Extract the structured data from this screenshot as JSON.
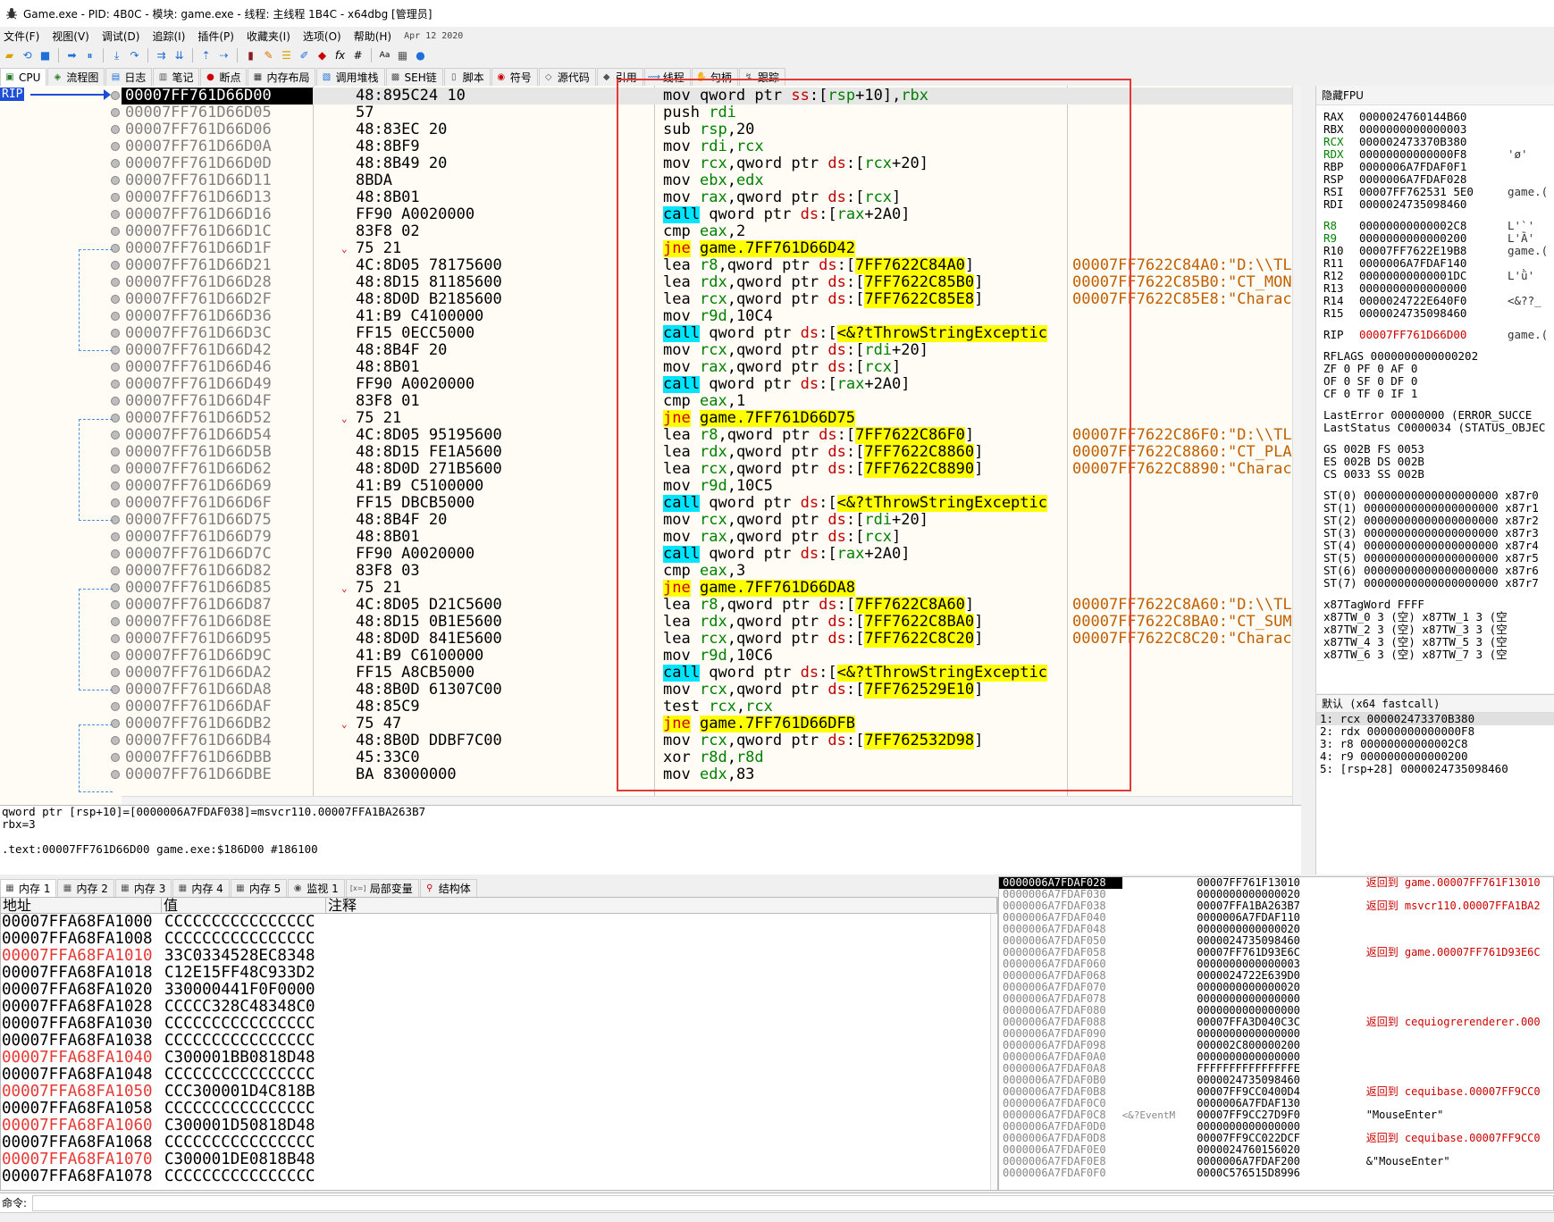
{
  "window": {
    "title": "Game.exe - PID: 4B0C - 模块: game.exe - 线程: 主线程 1B4C - x64dbg [管理员]"
  },
  "menu": [
    {
      "label": "文件(F)"
    },
    {
      "label": "视图(V)"
    },
    {
      "label": "调试(D)"
    },
    {
      "label": "追踪(I)"
    },
    {
      "label": "插件(P)"
    },
    {
      "label": "收藏夹(I)"
    },
    {
      "label": "选项(O)"
    },
    {
      "label": "帮助(H)"
    }
  ],
  "build_date": "Apr 12 2020",
  "tabs": [
    {
      "label": "CPU"
    },
    {
      "label": "流程图"
    },
    {
      "label": "日志"
    },
    {
      "label": "笔记"
    },
    {
      "label": "断点"
    },
    {
      "label": "内存布局"
    },
    {
      "label": "调用堆栈"
    },
    {
      "label": "SEH链"
    },
    {
      "label": "脚本"
    },
    {
      "label": "符号"
    },
    {
      "label": "源代码"
    },
    {
      "label": "引用"
    },
    {
      "label": "线程"
    },
    {
      "label": "句柄"
    },
    {
      "label": "跟踪"
    }
  ],
  "rip_label": "RIP",
  "disasm": [
    {
      "addr": "00007FF761D66D00",
      "bytes": "48:895C24 10",
      "ins": "mov qword ptr ss:[rsp+10],rbx",
      "cmt": "",
      "cur": true
    },
    {
      "addr": "00007FF761D66D05",
      "bytes": "57",
      "ins": "push rdi",
      "cmt": ""
    },
    {
      "addr": "00007FF761D66D06",
      "bytes": "48:83EC 20",
      "ins": "sub rsp,20",
      "cmt": ""
    },
    {
      "addr": "00007FF761D66D0A",
      "bytes": "48:8BF9",
      "ins": "mov rdi,rcx",
      "cmt": ""
    },
    {
      "addr": "00007FF761D66D0D",
      "bytes": "48:8B49 20",
      "ins": "mov rcx,qword ptr ds:[rcx+20]",
      "cmt": ""
    },
    {
      "addr": "00007FF761D66D11",
      "bytes": "8BDA",
      "ins": "mov ebx,edx",
      "cmt": ""
    },
    {
      "addr": "00007FF761D66D13",
      "bytes": "48:8B01",
      "ins": "mov rax,qword ptr ds:[rcx]",
      "cmt": ""
    },
    {
      "addr": "00007FF761D66D16",
      "bytes": "FF90 A0020000",
      "ins": "call qword ptr ds:[rax+2A0]",
      "cmt": "",
      "mn": "call"
    },
    {
      "addr": "00007FF761D66D1C",
      "bytes": "83F8 02",
      "ins": "cmp eax,2",
      "cmt": ""
    },
    {
      "addr": "00007FF761D66D1F",
      "bytes": "75 21",
      "ins": "jne game.7FF761D66D42",
      "cmt": "",
      "mn": "jcc",
      "jarrow": true
    },
    {
      "addr": "00007FF761D66D21",
      "bytes": "4C:8D05 78175600",
      "ins": "lea r8,qword ptr ds:[7FF7622C84A0]",
      "cmt": "00007FF7622C84A0:\"D:\\\\TL"
    },
    {
      "addr": "00007FF761D66D28",
      "bytes": "48:8D15 81185600",
      "ins": "lea rdx,qword ptr ds:[7FF7622C85B0]",
      "cmt": "00007FF7622C85B0:\"CT_MON"
    },
    {
      "addr": "00007FF761D66D2F",
      "bytes": "48:8D0D B2185600",
      "ins": "lea rcx,qword ptr ds:[7FF7622C85E8]",
      "cmt": "00007FF7622C85E8:\"Charac"
    },
    {
      "addr": "00007FF761D66D36",
      "bytes": "41:B9 C4100000",
      "ins": "mov r9d,10C4",
      "cmt": ""
    },
    {
      "addr": "00007FF761D66D3C",
      "bytes": "FF15 0ECC5000",
      "ins": "call qword ptr ds:[<&?tThrowStringExceptic",
      "cmt": "",
      "mn": "call"
    },
    {
      "addr": "00007FF761D66D42",
      "bytes": "48:8B4F 20",
      "ins": "mov rcx,qword ptr ds:[rdi+20]",
      "cmt": ""
    },
    {
      "addr": "00007FF761D66D46",
      "bytes": "48:8B01",
      "ins": "mov rax,qword ptr ds:[rcx]",
      "cmt": ""
    },
    {
      "addr": "00007FF761D66D49",
      "bytes": "FF90 A0020000",
      "ins": "call qword ptr ds:[rax+2A0]",
      "cmt": "",
      "mn": "call"
    },
    {
      "addr": "00007FF761D66D4F",
      "bytes": "83F8 01",
      "ins": "cmp eax,1",
      "cmt": ""
    },
    {
      "addr": "00007FF761D66D52",
      "bytes": "75 21",
      "ins": "jne game.7FF761D66D75",
      "cmt": "",
      "mn": "jcc",
      "jarrow": true
    },
    {
      "addr": "00007FF761D66D54",
      "bytes": "4C:8D05 95195600",
      "ins": "lea r8,qword ptr ds:[7FF7622C86F0]",
      "cmt": "00007FF7622C86F0:\"D:\\\\TL"
    },
    {
      "addr": "00007FF761D66D5B",
      "bytes": "48:8D15 FE1A5600",
      "ins": "lea rdx,qword ptr ds:[7FF7622C8860]",
      "cmt": "00007FF7622C8860:\"CT_PLA"
    },
    {
      "addr": "00007FF761D66D62",
      "bytes": "48:8D0D 271B5600",
      "ins": "lea rcx,qword ptr ds:[7FF7622C8890]",
      "cmt": "00007FF7622C8890:\"Charac"
    },
    {
      "addr": "00007FF761D66D69",
      "bytes": "41:B9 C5100000",
      "ins": "mov r9d,10C5",
      "cmt": ""
    },
    {
      "addr": "00007FF761D66D6F",
      "bytes": "FF15 DBCB5000",
      "ins": "call qword ptr ds:[<&?tThrowStringExceptic",
      "cmt": "",
      "mn": "call"
    },
    {
      "addr": "00007FF761D66D75",
      "bytes": "48:8B4F 20",
      "ins": "mov rcx,qword ptr ds:[rdi+20]",
      "cmt": ""
    },
    {
      "addr": "00007FF761D66D79",
      "bytes": "48:8B01",
      "ins": "mov rax,qword ptr ds:[rcx]",
      "cmt": ""
    },
    {
      "addr": "00007FF761D66D7C",
      "bytes": "FF90 A0020000",
      "ins": "call qword ptr ds:[rax+2A0]",
      "cmt": "",
      "mn": "call"
    },
    {
      "addr": "00007FF761D66D82",
      "bytes": "83F8 03",
      "ins": "cmp eax,3",
      "cmt": ""
    },
    {
      "addr": "00007FF761D66D85",
      "bytes": "75 21",
      "ins": "jne game.7FF761D66DA8",
      "cmt": "",
      "mn": "jcc",
      "jarrow": true
    },
    {
      "addr": "00007FF761D66D87",
      "bytes": "4C:8D05 D21C5600",
      "ins": "lea r8,qword ptr ds:[7FF7622C8A60]",
      "cmt": "00007FF7622C8A60:\"D:\\\\TL"
    },
    {
      "addr": "00007FF761D66D8E",
      "bytes": "48:8D15 0B1E5600",
      "ins": "lea rdx,qword ptr ds:[7FF7622C8BA0]",
      "cmt": "00007FF7622C8BA0:\"CT_SUM"
    },
    {
      "addr": "00007FF761D66D95",
      "bytes": "48:8D0D 841E5600",
      "ins": "lea rcx,qword ptr ds:[7FF7622C8C20]",
      "cmt": "00007FF7622C8C20:\"Charac"
    },
    {
      "addr": "00007FF761D66D9C",
      "bytes": "41:B9 C6100000",
      "ins": "mov r9d,10C6",
      "cmt": ""
    },
    {
      "addr": "00007FF761D66DA2",
      "bytes": "FF15 A8CB5000",
      "ins": "call qword ptr ds:[<&?tThrowStringExceptic",
      "cmt": "",
      "mn": "call"
    },
    {
      "addr": "00007FF761D66DA8",
      "bytes": "48:8B0D 61307C00",
      "ins": "mov rcx,qword ptr ds:[7FF762529E10]",
      "cmt": ""
    },
    {
      "addr": "00007FF761D66DAF",
      "bytes": "48:85C9",
      "ins": "test rcx,rcx",
      "cmt": ""
    },
    {
      "addr": "00007FF761D66DB2",
      "bytes": "75 47",
      "ins": "jne game.7FF761D66DFB",
      "cmt": "",
      "mn": "jcc",
      "jarrow": true
    },
    {
      "addr": "00007FF761D66DB4",
      "bytes": "48:8B0D DDBF7C00",
      "ins": "mov rcx,qword ptr ds:[7FF762532D98]",
      "cmt": ""
    },
    {
      "addr": "00007FF761D66DBB",
      "bytes": "45:33C0",
      "ins": "xor r8d,r8d",
      "cmt": ""
    },
    {
      "addr": "00007FF761D66DBE",
      "bytes": "BA 83000000",
      "ins": "mov edx,83",
      "cmt": ""
    }
  ],
  "registers": {
    "header": "隐藏FPU",
    "gp": [
      {
        "n": "RAX",
        "v": "0000024760144B60",
        "x": ""
      },
      {
        "n": "RBX",
        "v": "0000000000000003",
        "x": ""
      },
      {
        "n": "RCX",
        "v": "000002473370B380",
        "x": "",
        "ch": true
      },
      {
        "n": "RDX",
        "v": "00000000000000F8",
        "x": "'ø'",
        "ch": true
      },
      {
        "n": "RBP",
        "v": "0000006A7FDAF0F1",
        "x": ""
      },
      {
        "n": "RSP",
        "v": "0000006A7FDAF028",
        "x": ""
      },
      {
        "n": "RSI",
        "v": "00007FF762531 5E0",
        "x": "game.("
      },
      {
        "n": "RDI",
        "v": "0000024735098460",
        "x": ""
      }
    ],
    "ext": [
      {
        "n": "R8",
        "v": "00000000000002C8",
        "x": "L'`'",
        "ch": true
      },
      {
        "n": "R9",
        "v": "0000000000000200",
        "x": "L'Ȁ'",
        "ch": true
      },
      {
        "n": "R10",
        "v": "00007FF7622E19B8",
        "x": "game.("
      },
      {
        "n": "R11",
        "v": "0000006A7FDAF140",
        "x": ""
      },
      {
        "n": "R12",
        "v": "00000000000001DC",
        "x": "L'ǜ'"
      },
      {
        "n": "R13",
        "v": "0000000000000000",
        "x": ""
      },
      {
        "n": "R14",
        "v": "0000024722E640F0",
        "x": "<&??_"
      },
      {
        "n": "R15",
        "v": "0000024735098460",
        "x": ""
      }
    ],
    "rip": {
      "n": "RIP",
      "v": "00007FF761D66D00",
      "x": "game.("
    },
    "flags": [
      "RFLAGS   0000000000000202",
      "ZF 0  PF 0  AF 0",
      "OF 0  SF 0  DF 0",
      "CF 0  TF 0  IF 1"
    ],
    "errors": [
      "LastError  00000000 (ERROR_SUCCE",
      "LastStatus C0000034 (STATUS_OBJEC"
    ],
    "segs": [
      "GS 002B  FS 0053",
      "ES 002B  DS 002B",
      "CS 0033  SS 002B"
    ],
    "fpu": [
      "ST(0) 00000000000000000000 x87r0",
      "ST(1) 00000000000000000000 x87r1",
      "ST(2) 00000000000000000000 x87r2",
      "ST(3) 00000000000000000000 x87r3",
      "ST(4) 00000000000000000000 x87r4",
      "ST(5) 00000000000000000000 x87r5",
      "ST(6) 00000000000000000000 x87r6",
      "ST(7) 00000000000000000000 x87r7"
    ],
    "tag": [
      "x87TagWord FFFF",
      "x87TW_0 3 (空)     x87TW_1 3 (空",
      "x87TW_2 3 (空)     x87TW_3 3 (空",
      "x87TW_4 3 (空)     x87TW_5 3 (空",
      "x87TW_6 3 (空)     x87TW_7 3 (空"
    ]
  },
  "args": {
    "header": "默认 (x64 fastcall)",
    "rows": [
      "1: rcx 000002473370B380",
      "2: rdx 00000000000000F8",
      "3: r8 00000000000002C8",
      "4: r9 0000000000000200",
      "5: [rsp+28] 0000024735098460"
    ]
  },
  "info": [
    "qword ptr [rsp+10]=[0000006A7FDAF038]=msvcr110.00007FFA1BA263B7",
    "rbx=3",
    "",
    ".text:00007FF761D66D00 game.exe:$186D00 #186100"
  ],
  "dump_tabs": [
    {
      "label": "内存 1"
    },
    {
      "label": "内存 2"
    },
    {
      "label": "内存 3"
    },
    {
      "label": "内存 4"
    },
    {
      "label": "内存 5"
    },
    {
      "label": "监视 1"
    },
    {
      "label": "局部变量"
    },
    {
      "label": "结构体"
    }
  ],
  "dump": {
    "headers": [
      "地址",
      "值",
      "注释"
    ],
    "rows": [
      {
        "a": "00007FFA68FA1000",
        "v": "CCCCCCCCCCCCCCCC"
      },
      {
        "a": "00007FFA68FA1008",
        "v": "CCCCCCCCCCCCCCCC"
      },
      {
        "a": "00007FFA68FA1010",
        "v": "33C0334528EC8348",
        "red": true
      },
      {
        "a": "00007FFA68FA1018",
        "v": "C12E15FF48C933D2"
      },
      {
        "a": "00007FFA68FA1020",
        "v": "330000441F0F0000"
      },
      {
        "a": "00007FFA68FA1028",
        "v": "CCCCC328C48348C0"
      },
      {
        "a": "00007FFA68FA1030",
        "v": "CCCCCCCCCCCCCCCC"
      },
      {
        "a": "00007FFA68FA1038",
        "v": "CCCCCCCCCCCCCCCC"
      },
      {
        "a": "00007FFA68FA1040",
        "v": "C300001BB0818D48",
        "red": true
      },
      {
        "a": "00007FFA68FA1048",
        "v": "CCCCCCCCCCCCCCCC"
      },
      {
        "a": "00007FFA68FA1050",
        "v": "CCC300001D4C818B",
        "red": true
      },
      {
        "a": "00007FFA68FA1058",
        "v": "CCCCCCCCCCCCCCCC"
      },
      {
        "a": "00007FFA68FA1060",
        "v": "C300001D50818D48",
        "red": true
      },
      {
        "a": "00007FFA68FA1068",
        "v": "CCCCCCCCCCCCCCCC"
      },
      {
        "a": "00007FFA68FA1070",
        "v": "C300001DE0818B48",
        "red": true
      },
      {
        "a": "00007FFA68FA1078",
        "v": "CCCCCCCCCCCCCCCC"
      }
    ]
  },
  "stack": [
    {
      "a": "0000006A7FDAF028",
      "x": "",
      "v": "00007FF761F13010",
      "c": "返回到 game.00007FF761F13010",
      "cur": true
    },
    {
      "a": "0000006A7FDAF030",
      "x": "",
      "v": "0000000000000020",
      "c": ""
    },
    {
      "a": "0000006A7FDAF038",
      "x": "",
      "v": "00007FFA1BA263B7",
      "c": "返回到 msvcr110.00007FFA1BA2"
    },
    {
      "a": "0000006A7FDAF040",
      "x": "",
      "v": "0000006A7FDAF110",
      "c": ""
    },
    {
      "a": "0000006A7FDAF048",
      "x": "",
      "v": "0000000000000020",
      "c": ""
    },
    {
      "a": "0000006A7FDAF050",
      "x": "",
      "v": "0000024735098460",
      "c": ""
    },
    {
      "a": "0000006A7FDAF058",
      "x": "",
      "v": "00007FF761D93E6C",
      "c": "返回到 game.00007FF761D93E6C"
    },
    {
      "a": "0000006A7FDAF060",
      "x": "",
      "v": "0000000000000003",
      "c": ""
    },
    {
      "a": "0000006A7FDAF068",
      "x": "",
      "v": "0000024722E639D0",
      "c": ""
    },
    {
      "a": "0000006A7FDAF070",
      "x": "",
      "v": "0000000000000020",
      "c": ""
    },
    {
      "a": "0000006A7FDAF078",
      "x": "",
      "v": "0000000000000000",
      "c": ""
    },
    {
      "a": "0000006A7FDAF080",
      "x": "",
      "v": "0000000000000000",
      "c": ""
    },
    {
      "a": "0000006A7FDAF088",
      "x": "",
      "v": "00007FFA3D040C3C",
      "c": "返回到 cequiogrerenderer.000"
    },
    {
      "a": "0000006A7FDAF090",
      "x": "",
      "v": "0000000000000000",
      "c": ""
    },
    {
      "a": "0000006A7FDAF098",
      "x": "",
      "v": "000002C800000200",
      "c": ""
    },
    {
      "a": "0000006A7FDAF0A0",
      "x": "",
      "v": "0000000000000000",
      "c": ""
    },
    {
      "a": "0000006A7FDAF0A8",
      "x": "",
      "v": "FFFFFFFFFFFFFFFE",
      "c": ""
    },
    {
      "a": "0000006A7FDAF0B0",
      "x": "",
      "v": "0000024735098460",
      "c": ""
    },
    {
      "a": "0000006A7FDAF0B8",
      "x": "",
      "v": "00007FF9CC0400D4",
      "c": "返回到 cequibase.00007FF9CC0"
    },
    {
      "a": "0000006A7FDAF0C0",
      "x": "",
      "v": "0000006A7FDAF130",
      "c": ""
    },
    {
      "a": "0000006A7FDAF0C8",
      "x": "<&?EventM",
      "v": "00007FF9CC27D9F0",
      "c": "\"MouseEnter\"",
      "plain": true
    },
    {
      "a": "0000006A7FDAF0D0",
      "x": "",
      "v": "0000000000000000",
      "c": ""
    },
    {
      "a": "0000006A7FDAF0D8",
      "x": "",
      "v": "00007FF9CC022DCF",
      "c": "返回到 cequibase.00007FF9CC0"
    },
    {
      "a": "0000006A7FDAF0E0",
      "x": "",
      "v": "0000024760156020",
      "c": ""
    },
    {
      "a": "0000006A7FDAF0E8",
      "x": "",
      "v": "0000006A7FDAF200",
      "c": "&\"MouseEnter\"",
      "plain": true
    },
    {
      "a": "0000006A7FDAF0F0",
      "x": "",
      "v": "0000C576515D8996",
      "c": ""
    }
  ],
  "cmd_label": "命令:"
}
